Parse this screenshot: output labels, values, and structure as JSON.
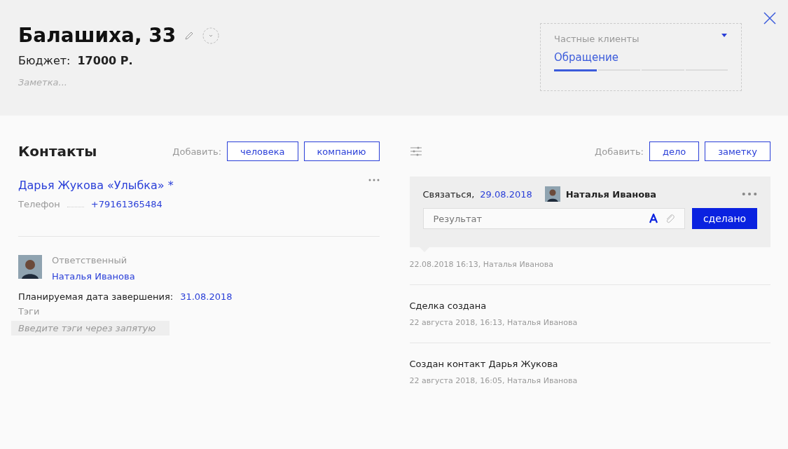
{
  "header": {
    "title": "Балашиха, 33",
    "budget_label": "Бюджет:",
    "budget_value": "17000 Р.",
    "note_placeholder": "Заметка..."
  },
  "pipeline": {
    "name": "Частные клиенты",
    "stage": "Обращение",
    "steps": [
      {
        "selected": true
      },
      {
        "selected": false
      },
      {
        "selected": false
      },
      {
        "selected": false
      }
    ]
  },
  "contacts": {
    "title": "Контакты",
    "add_label": "Добавить:",
    "add_buttons": [
      "человека",
      "компанию"
    ],
    "contact": {
      "name": "Дарья Жукова «Улыбка» *",
      "phone_label": "Телефон",
      "phone": "+79161365484"
    },
    "responsible_label": "Ответственный",
    "responsible": "Наталья Иванова",
    "due_label": "Планируемая дата завершения:",
    "due_date": "31.08.2018",
    "tags_label": "Тэги",
    "tags_placeholder": "Введите тэги через запятую"
  },
  "feed": {
    "add_label": "Добавить:",
    "add_buttons": [
      "дело",
      "заметку"
    ],
    "task": {
      "action": "Связаться,",
      "date": "29.08.2018",
      "user": "Наталья Иванова",
      "result_placeholder": "Результат",
      "done_button": "сделано",
      "meta": "22.08.2018 16:13, Наталья Иванова"
    },
    "events": [
      {
        "title": "Сделка создана",
        "meta": "22 августа 2018, 16:13, Наталья Иванова"
      },
      {
        "title": "Создан контакт Дарья Жукова",
        "meta": "22 августа 2018, 16:05, Наталья Иванова"
      }
    ]
  }
}
